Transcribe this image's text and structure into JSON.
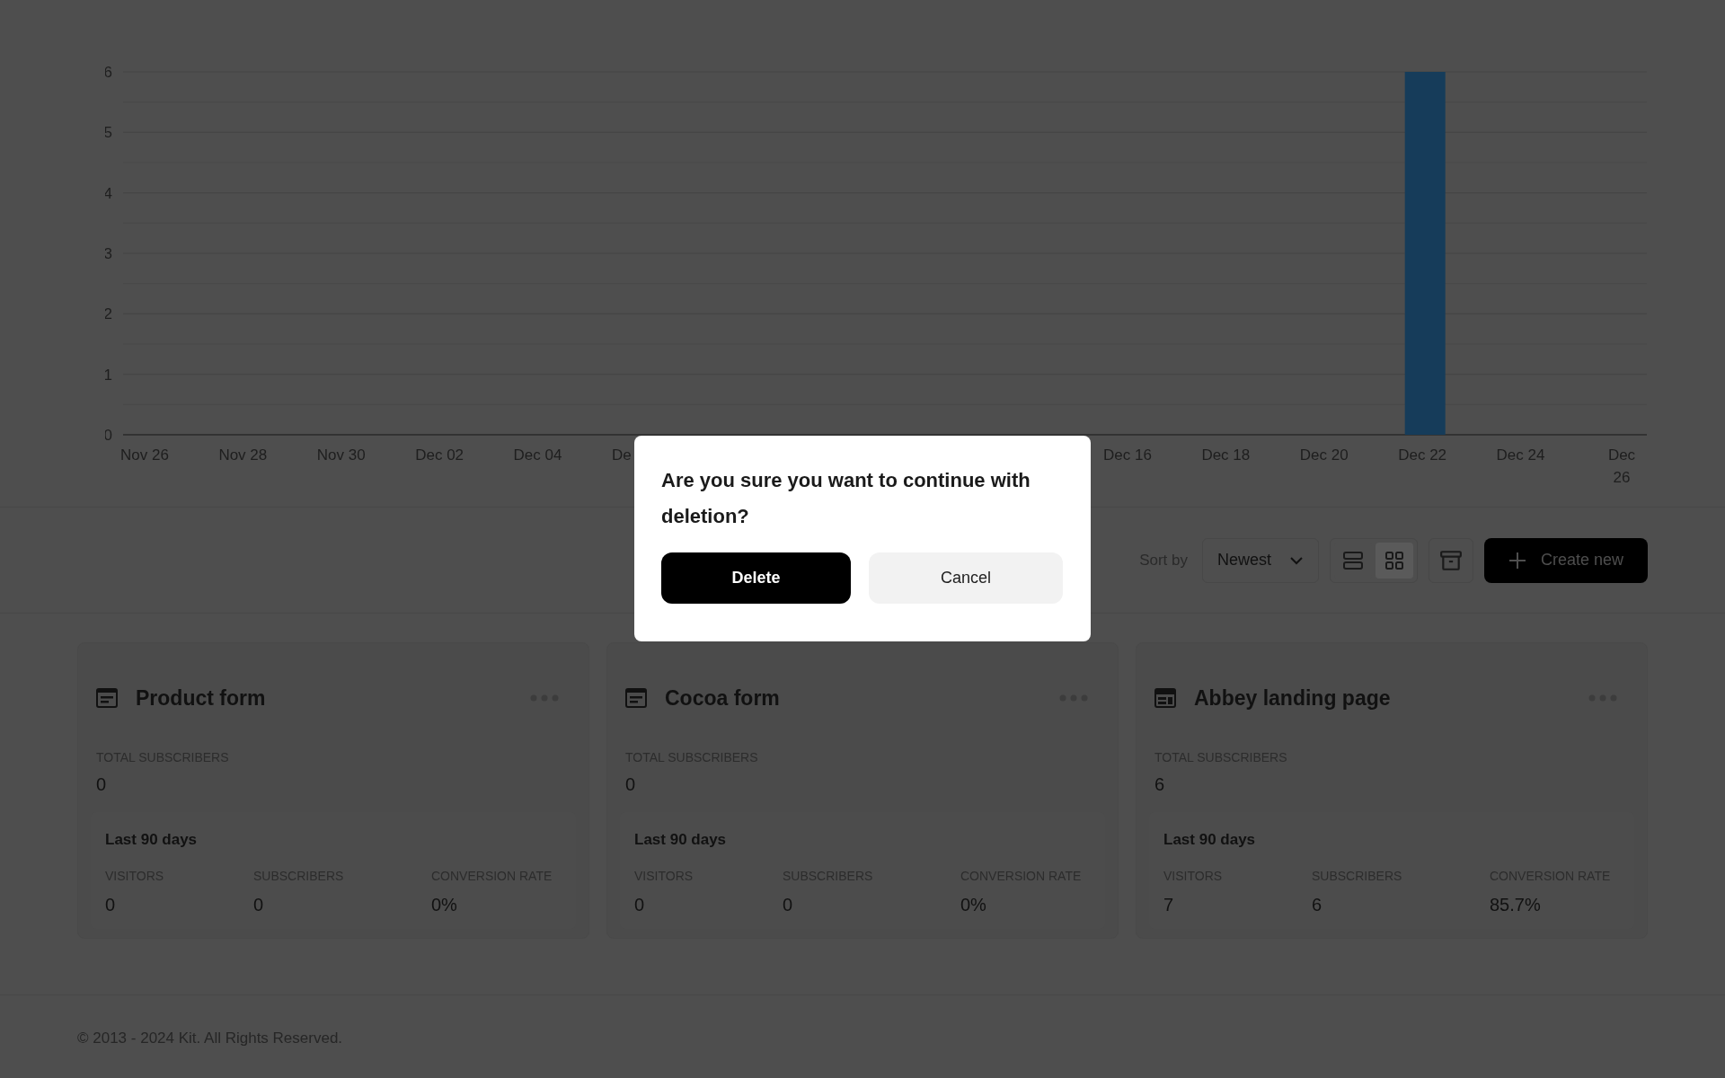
{
  "chart": {
    "chart_data": {
      "type": "bar",
      "ylim": [
        0,
        6
      ],
      "yticks": [
        0,
        1,
        2,
        3,
        4,
        5,
        6
      ],
      "grid": true,
      "categories": [
        "Nov 26",
        "Nov 28",
        "Nov 30",
        "Dec 02",
        "Dec 04",
        "De",
        null,
        null,
        null,
        null,
        "Dec 16",
        "Dec 18",
        "Dec 20",
        "Dec 22",
        "Dec 24",
        "Dec 26"
      ],
      "series": [
        {
          "color": "#163c5a",
          "values": [
            0,
            0,
            0,
            0,
            0,
            0,
            0,
            0,
            0,
            0,
            0,
            0,
            0,
            6,
            0,
            0
          ]
        }
      ]
    }
  },
  "toolbar": {
    "sort_label": "Sort by",
    "sort_value": "Newest",
    "views": [
      {
        "kind": "list",
        "selected": false
      },
      {
        "kind": "grid",
        "selected": true
      }
    ],
    "create_button": "Create new"
  },
  "cards": [
    {
      "kind": "form",
      "title": "Product form",
      "total_label": "TOTAL SUBSCRIBERS",
      "total": "0",
      "period": "Last 90 days",
      "stats": [
        {
          "label": "VISITORS",
          "value": "0"
        },
        {
          "label": "SUBSCRIBERS",
          "value": "0"
        },
        {
          "label": "CONVERSION RATE",
          "value": "0%"
        }
      ]
    },
    {
      "kind": "form",
      "title": "Cocoa form",
      "total_label": "TOTAL SUBSCRIBERS",
      "total": "0",
      "period": "Last 90 days",
      "stats": [
        {
          "label": "VISITORS",
          "value": "0"
        },
        {
          "label": "SUBSCRIBERS",
          "value": "0"
        },
        {
          "label": "CONVERSION RATE",
          "value": "0%"
        }
      ]
    },
    {
      "kind": "landing",
      "title": "Abbey landing page",
      "total_label": "TOTAL SUBSCRIBERS",
      "total": "6",
      "period": "Last 90 days",
      "stats": [
        {
          "label": "VISITORS",
          "value": "7"
        },
        {
          "label": "SUBSCRIBERS",
          "value": "6"
        },
        {
          "label": "CONVERSION RATE",
          "value": "85.7%"
        }
      ]
    }
  ],
  "footer": "© 2013 - 2024 Kit. All Rights Reserved.",
  "dialog": {
    "message": "Are you sure you want to continue with deletion?",
    "confirm": "Delete",
    "cancel": "Cancel"
  }
}
